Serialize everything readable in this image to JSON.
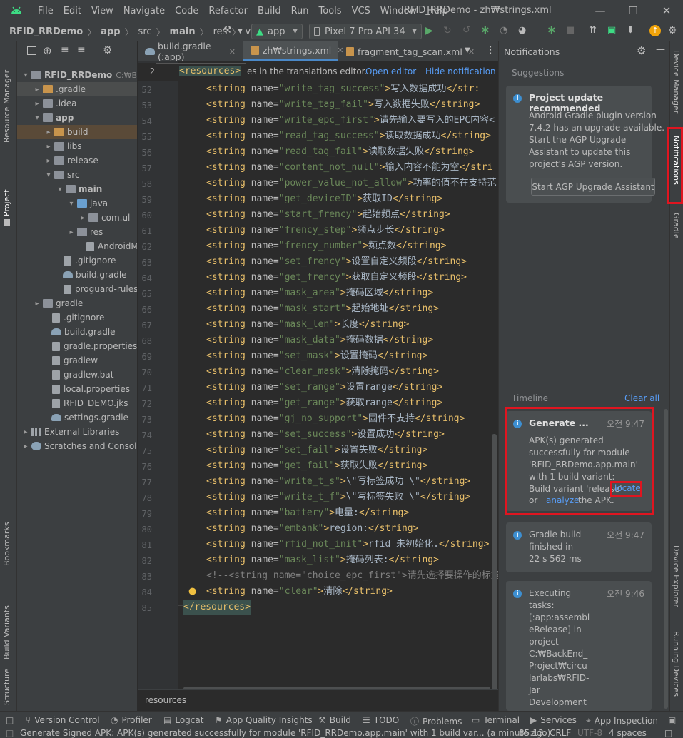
{
  "window": {
    "title": "RFID_RRDemo - zh₩strings.xml"
  },
  "menu": [
    "File",
    "Edit",
    "View",
    "Navigate",
    "Code",
    "Refactor",
    "Build",
    "Run",
    "Tools",
    "VCS",
    "Window",
    "Help"
  ],
  "breadcrumb": [
    "RFID_RRDemo",
    "app",
    "src",
    "main",
    "res",
    "values-z"
  ],
  "toolbar": {
    "run_config": "app",
    "device": "Pixel 7 Pro API 34"
  },
  "left_strip": {
    "resource_manager": "Resource Manager",
    "project": "Project",
    "bookmarks": "Bookmarks",
    "build_variants": "Build Variants",
    "structure": "Structure"
  },
  "project_tree": [
    {
      "label": "RFID_RRDemo",
      "suffix": "C:₩Bac",
      "bold": true
    },
    {
      "label": ".gradle"
    },
    {
      "label": ".idea"
    },
    {
      "label": "app",
      "bold": true
    },
    {
      "label": "build"
    },
    {
      "label": "libs"
    },
    {
      "label": "release"
    },
    {
      "label": "src"
    },
    {
      "label": "main",
      "bold": true
    },
    {
      "label": "java"
    },
    {
      "label": "com.ul"
    },
    {
      "label": "res"
    },
    {
      "label": "AndroidM"
    },
    {
      "label": ".gitignore"
    },
    {
      "label": "build.gradle"
    },
    {
      "label": "proguard-rules.p"
    },
    {
      "label": "gradle"
    },
    {
      "label": ".gitignore"
    },
    {
      "label": "build.gradle"
    },
    {
      "label": "gradle.properties"
    },
    {
      "label": "gradlew"
    },
    {
      "label": "gradlew.bat"
    },
    {
      "label": "local.properties"
    },
    {
      "label": "RFID_DEMO.jks"
    },
    {
      "label": "settings.gradle"
    },
    {
      "label": "External Libraries"
    },
    {
      "label": "Scratches and Consoles"
    }
  ],
  "tabs": [
    {
      "label": "build.gradle (:app)"
    },
    {
      "label": "zh₩strings.xml",
      "active": true
    },
    {
      "label": "fragment_tag_scan.xml"
    }
  ],
  "editor_banner": {
    "line": "2",
    "tag": "<resources>",
    "text": "es in the translations editor.",
    "open_editor": "Open editor",
    "hide": "Hide notification"
  },
  "code_lines": [
    {
      "n": "52",
      "name": "write_tag_success",
      "val": "写入数据成功",
      "close": "</str:"
    },
    {
      "n": "53",
      "name": "write_tag_fail",
      "val": "写入数据失败",
      "close": "</string>"
    },
    {
      "n": "54",
      "name": "write_epc_first",
      "val": "请先输入要写入的EPC内容<",
      "close": ""
    },
    {
      "n": "55",
      "name": "read_tag_success",
      "val": "读取数据成功",
      "close": "</string>"
    },
    {
      "n": "56",
      "name": "read_tag_fail",
      "val": "读取数据失败",
      "close": "</string>"
    },
    {
      "n": "57",
      "name": "content_not_null",
      "val": "输入内容不能为空",
      "close": "</stri"
    },
    {
      "n": "58",
      "name": "power_value_not_allow",
      "val": "功率的值不在支持范",
      "close": ""
    },
    {
      "n": "59",
      "name": "get_deviceID",
      "val": "获取ID",
      "close": "</string>"
    },
    {
      "n": "60",
      "name": "start_frency",
      "val": "起始频点",
      "close": "</string>"
    },
    {
      "n": "61",
      "name": "frency_step",
      "val": "频点步长",
      "close": "</string>"
    },
    {
      "n": "62",
      "name": "frency_number",
      "val": "频点数",
      "close": "</string>"
    },
    {
      "n": "63",
      "name": "set_frency",
      "val": "设置自定义频段",
      "close": "</string>"
    },
    {
      "n": "64",
      "name": "get_frency",
      "val": "获取自定义频段",
      "close": "</string>"
    },
    {
      "n": "65",
      "name": "mask_area",
      "val": "掩码区域",
      "close": "</string>"
    },
    {
      "n": "66",
      "name": "mask_start",
      "val": "起始地址",
      "close": "</string>"
    },
    {
      "n": "67",
      "name": "mask_len",
      "val": "长度",
      "close": "</string>"
    },
    {
      "n": "68",
      "name": "mask_data",
      "val": "掩码数据",
      "close": "</string>"
    },
    {
      "n": "69",
      "name": "set_mask",
      "val": "设置掩码",
      "close": "</string>"
    },
    {
      "n": "70",
      "name": "clear_mask",
      "val": "清除掩码",
      "close": "</string>"
    },
    {
      "n": "71",
      "name": "set_range",
      "val": "设置range",
      "close": "</string>"
    },
    {
      "n": "72",
      "name": "get_range",
      "val": "获取range",
      "close": "</string>"
    },
    {
      "n": "73",
      "name": "gj_no_support",
      "val": "固件不支持",
      "close": "</string>"
    },
    {
      "n": "74",
      "name": "set_success",
      "val": "设置成功",
      "close": "</string>"
    },
    {
      "n": "75",
      "name": "set_fail",
      "val": "设置失败",
      "close": "</string>"
    },
    {
      "n": "76",
      "name": "get_fail",
      "val": "获取失败",
      "close": "</string>"
    },
    {
      "n": "77",
      "name": "write_t_s",
      "val": "\\\"写标签成功 \\\"",
      "close": "</string>"
    },
    {
      "n": "78",
      "name": "write_t_f",
      "val": "\\\"写标签失败 \\\"",
      "close": "</string>"
    },
    {
      "n": "79",
      "name": "battery",
      "val": "电量:",
      "close": "</string>"
    },
    {
      "n": "80",
      "name": "embank",
      "val": "region:",
      "close": "</string>"
    },
    {
      "n": "81",
      "name": "rfid_not_init",
      "val": "rfid 未初始化.",
      "close": "</string>"
    },
    {
      "n": "82",
      "name": "mask_list",
      "val": "掩码列表:",
      "close": "</string>"
    }
  ],
  "comment_line": {
    "n": "83",
    "text": "<!--<string name=\"choice_epc_first\">请先选择要操作的标签"
  },
  "line84": {
    "n": "84",
    "name": "clear",
    "val": "清除",
    "close": "</string>"
  },
  "line85": {
    "n": "85",
    "text": "</resources>"
  },
  "editor_breadcrumb": "resources",
  "notifications": {
    "panel_title": "Notifications",
    "suggestions_label": "Suggestions",
    "suggestion": {
      "title": "Project update recommended",
      "body": "Android Gradle plugin version\n7.4.2 has an upgrade available.\nStart the AGP Upgrade\nAssistant to update this\nproject's AGP version.",
      "button": "Start AGP Upgrade Assistant"
    },
    "timeline_label": "Timeline",
    "clear_all": "Clear all",
    "items": [
      {
        "title": "Generate ...",
        "time": "오전 9:47",
        "body": "APK(s) generated\nsuccessfully for module\n'RFID_RRDemo.app.main'\nwith 1 build variant:\nBuild variant 'release'",
        "locate": "locate",
        "or": "or",
        "analyze": "analyze",
        "tail": "the APK."
      },
      {
        "title": "Gradle build\nfinished in\n22 s 562 ms",
        "time": "오전 9:47"
      },
      {
        "title": "Executing\ntasks:\n[:app:assembl\neRelease] in\nproject\nC:₩BackEnd_\nProject₩circu\nlarlabs₩RFID-\nJar\nDevelopment",
        "time": "오전 9:46"
      }
    ]
  },
  "right_strip": {
    "device_manager": "Device Manager",
    "notifications": "Notifications",
    "gradle": "Gradle",
    "device_explorer": "Device Explorer",
    "running_devices": "Running Devices"
  },
  "status_tabs": [
    "Version Control",
    "Profiler",
    "Logcat",
    "App Quality Insights",
    "Build",
    "TODO",
    "Problems",
    "Terminal",
    "Services",
    "App Inspection"
  ],
  "status_message": "Generate Signed APK: APK(s) generated successfully for module 'RFID_RRDemo.app.main' with 1 build var... (a minute ago)",
  "status_right": {
    "position": "85:13",
    "line_sep": "CRLF",
    "encoding": "UTF-8",
    "indent": "4 spaces"
  },
  "colors": {
    "highlight_box": "#e01520",
    "link": "#589df6",
    "accent_tab": "#4a88c7"
  }
}
